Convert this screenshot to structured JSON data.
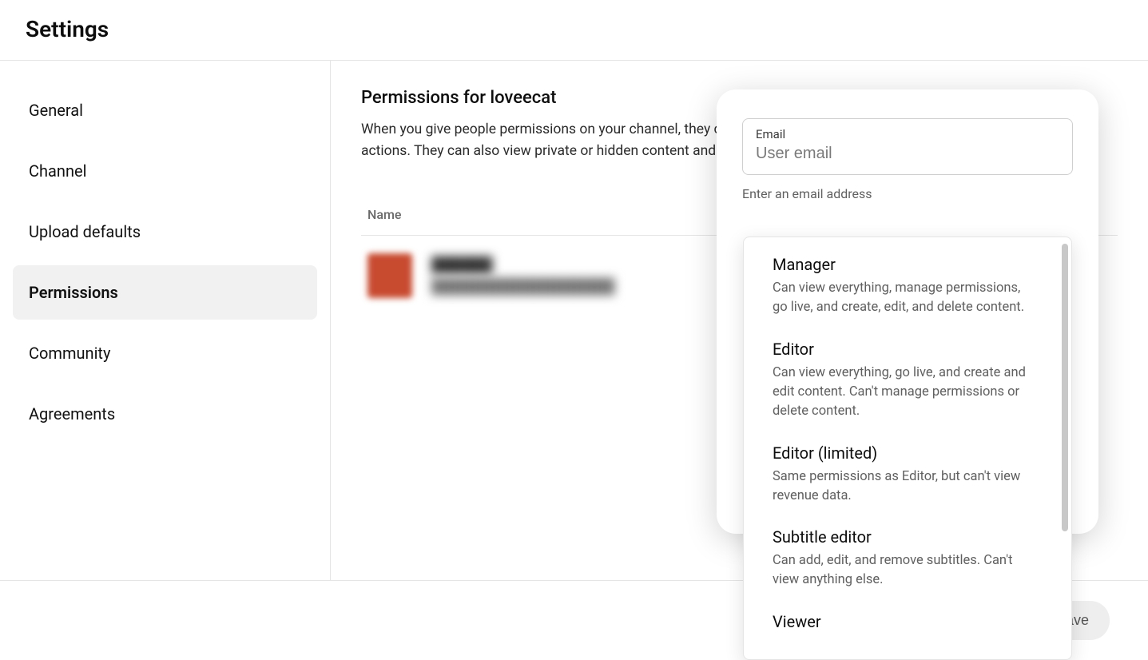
{
  "header": {
    "title": "Settings"
  },
  "sidebar": {
    "items": [
      {
        "label": "General"
      },
      {
        "label": "Channel"
      },
      {
        "label": "Upload defaults"
      },
      {
        "label": "Permissions"
      },
      {
        "label": "Community"
      },
      {
        "label": "Agreements"
      }
    ],
    "active_index": 3
  },
  "main": {
    "heading": "Permissions for loveecat",
    "description": "When you give people permissions on your channel, they can act on your behalf and perform certain actions. They can also view private or hidden content and data.",
    "table_header_name": "Name",
    "rows": [
      {
        "name": "██████",
        "email": "██████████████████"
      }
    ]
  },
  "popover": {
    "email_label": "Email",
    "email_placeholder": "User email",
    "email_hint": "Enter an email address"
  },
  "dropdown": {
    "options": [
      {
        "title": "Manager",
        "desc": "Can view everything, manage permissions, go live, and create, edit, and delete content."
      },
      {
        "title": "Editor",
        "desc": "Can view everything, go live, and create and edit content. Can't manage permissions or delete content."
      },
      {
        "title": "Editor (limited)",
        "desc": "Same permissions as Editor, but can't view revenue data."
      },
      {
        "title": "Subtitle editor",
        "desc": "Can add, edit, and remove subtitles. Can't view anything else."
      },
      {
        "title": "Viewer",
        "desc": ""
      }
    ]
  },
  "footer": {
    "save_label": "Save"
  }
}
